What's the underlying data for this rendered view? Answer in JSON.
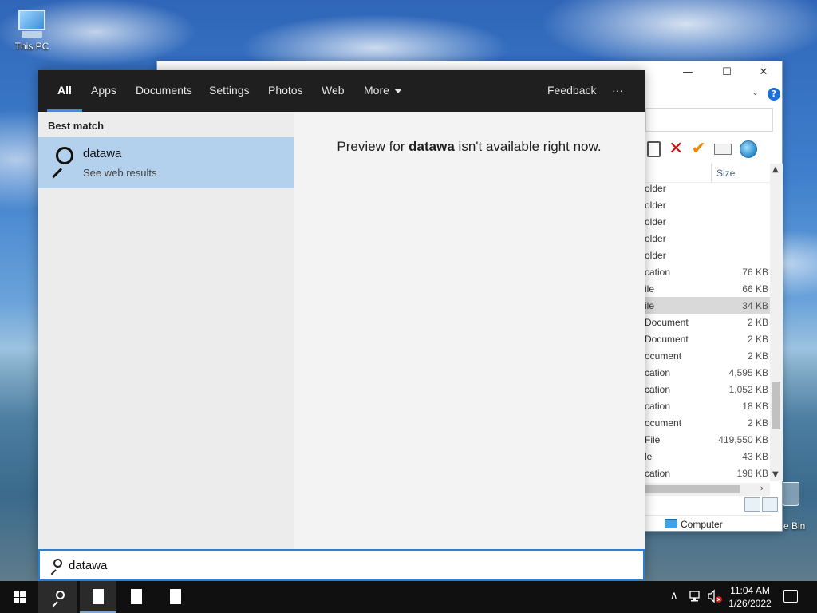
{
  "desktop": {
    "this_pc_label": "This PC",
    "recycle_label": "e Bin"
  },
  "explorer": {
    "minimize": "—",
    "maximize": "☐",
    "close": "✕",
    "help": "?",
    "column_size": "Size",
    "rows": [
      {
        "type": "older",
        "size": ""
      },
      {
        "type": "older",
        "size": ""
      },
      {
        "type": "older",
        "size": ""
      },
      {
        "type": "older",
        "size": ""
      },
      {
        "type": "older",
        "size": ""
      },
      {
        "type": "cation",
        "size": "76 KB"
      },
      {
        "type": "ile",
        "size": "66 KB"
      },
      {
        "type": "ile",
        "size": "34 KB"
      },
      {
        "type": "Document",
        "size": "2 KB"
      },
      {
        "type": "Document",
        "size": "2 KB"
      },
      {
        "type": "ocument",
        "size": "2 KB"
      },
      {
        "type": "cation",
        "size": "4,595 KB"
      },
      {
        "type": "cation",
        "size": "1,052 KB"
      },
      {
        "type": "cation",
        "size": "18 KB"
      },
      {
        "type": "ocument",
        "size": "2 KB"
      },
      {
        "type": "File",
        "size": "419,550 KB"
      },
      {
        "type": "le",
        "size": "43 KB"
      },
      {
        "type": "cation",
        "size": "198 KB"
      }
    ],
    "status_location": "Computer"
  },
  "search": {
    "tabs": {
      "all": "All",
      "apps": "Apps",
      "documents": "Documents",
      "settings": "Settings",
      "photos": "Photos",
      "web": "Web",
      "more": "More",
      "feedback": "Feedback",
      "ellipsis": "···"
    },
    "best_match_heading": "Best match",
    "result": {
      "title": "datawa",
      "subtitle": "See web results"
    },
    "preview": {
      "prefix": "Preview for ",
      "term": "datawa",
      "suffix": " isn't available right now."
    },
    "query": "datawa"
  },
  "taskbar": {
    "time": "11:04 AM",
    "date": "1/26/2022",
    "tray_up": "∧"
  }
}
